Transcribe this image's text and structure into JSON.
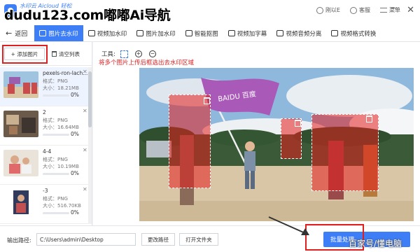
{
  "titlebar": {
    "app_title": "水印云 Aicloud 轻松",
    "watermark_overlay": "dudu123.com嘟嘟Ai导航",
    "actions": [
      {
        "label": "刚以E",
        "icon": "user-icon"
      },
      {
        "label": "客服",
        "icon": "headset-icon"
      },
      {
        "label": "菜单",
        "icon": "menu-icon"
      }
    ]
  },
  "tabbar": {
    "back": "返回",
    "tabs": [
      {
        "label": "图片去水印",
        "active": true
      },
      {
        "label": "视频加水印",
        "active": false
      },
      {
        "label": "图片加水印",
        "active": false
      },
      {
        "label": "智能抠图",
        "active": false
      },
      {
        "label": "视频加字幕",
        "active": false
      },
      {
        "label": "视频音频分离",
        "active": false
      },
      {
        "label": "视频格式转换",
        "active": false
      }
    ]
  },
  "sidebar": {
    "add_label": "+ 添加图片",
    "clear_label": "清空列表",
    "files": [
      {
        "name": "pexels-ron-lach...",
        "format": "格式：PNG",
        "size": "大小：18.21MB",
        "progress": 0,
        "percent": "0%"
      },
      {
        "name": "2",
        "format": "格式：PNG",
        "size": "大小：16.64MB",
        "progress": 0,
        "percent": "0%"
      },
      {
        "name": "4-4",
        "format": "格式：PNG",
        "size": "大小：10.19MB",
        "progress": 0,
        "percent": "0%"
      },
      {
        "name": "-3",
        "format": "格式：PNG",
        "size": "大小：516.70KB",
        "progress": 0,
        "percent": "0%"
      }
    ]
  },
  "main": {
    "tools_label": "工具:",
    "hint": "将多个图片上传后框选出去水印区域",
    "flag_text": "BAIDU 百度"
  },
  "bottom": {
    "output_label": "输出路径:",
    "output_path": "C:\\Users\\admin\\Desktop",
    "change_dir": "更改路径",
    "open_folder": "打开文件夹",
    "batch_label": "批量处理"
  },
  "credit": "百家号/懂电脑",
  "colors": {
    "accent": "#3d7ef7",
    "annotation_red": "#e02020"
  }
}
